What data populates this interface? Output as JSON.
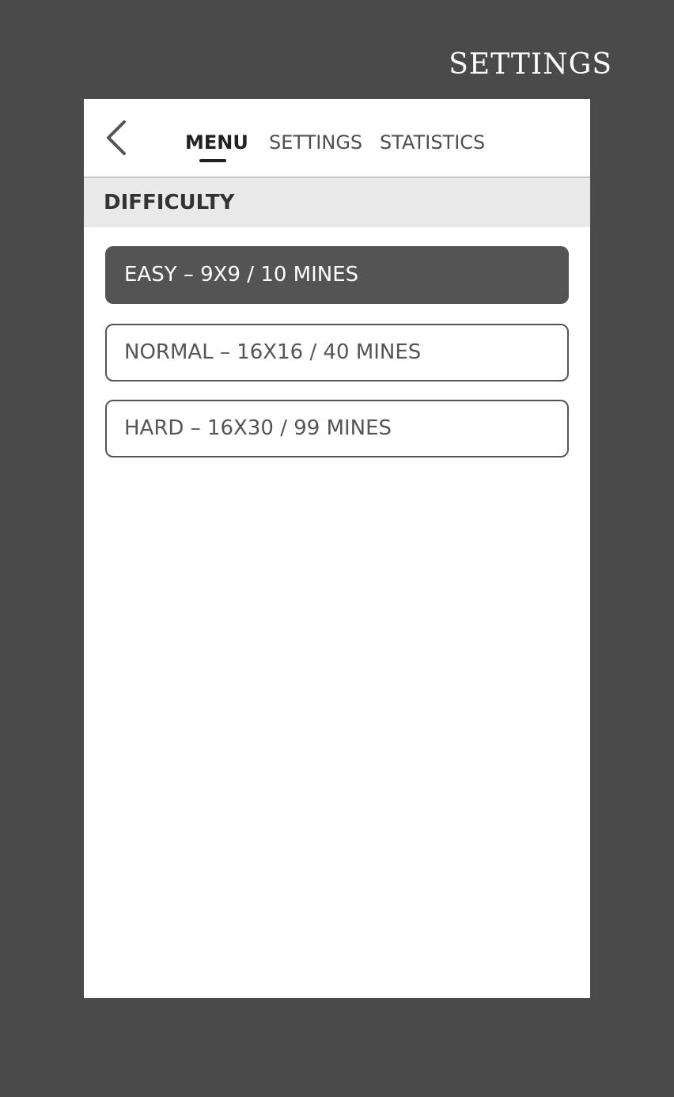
{
  "page_title": "SETTINGS",
  "back_icon": "chevron-left-icon",
  "tabs": [
    {
      "label": "MENU",
      "active": true
    },
    {
      "label": "SETTINGS",
      "active": false
    },
    {
      "label": "STATISTICS",
      "active": false
    }
  ],
  "difficulty": {
    "title": "DIFFICULTY",
    "options": [
      {
        "label": "EASY – 9X9 / 10 MINES",
        "selected": true
      },
      {
        "label": "NORMAL – 16X16 / 40 MINES",
        "selected": false
      },
      {
        "label": "HARD – 16X30 / 99 MINES",
        "selected": false
      }
    ]
  },
  "colors": {
    "background": "#4a4a4a",
    "screen": "#ffffff",
    "selected_option": "#545454",
    "section_header": "#e9e9e9"
  }
}
